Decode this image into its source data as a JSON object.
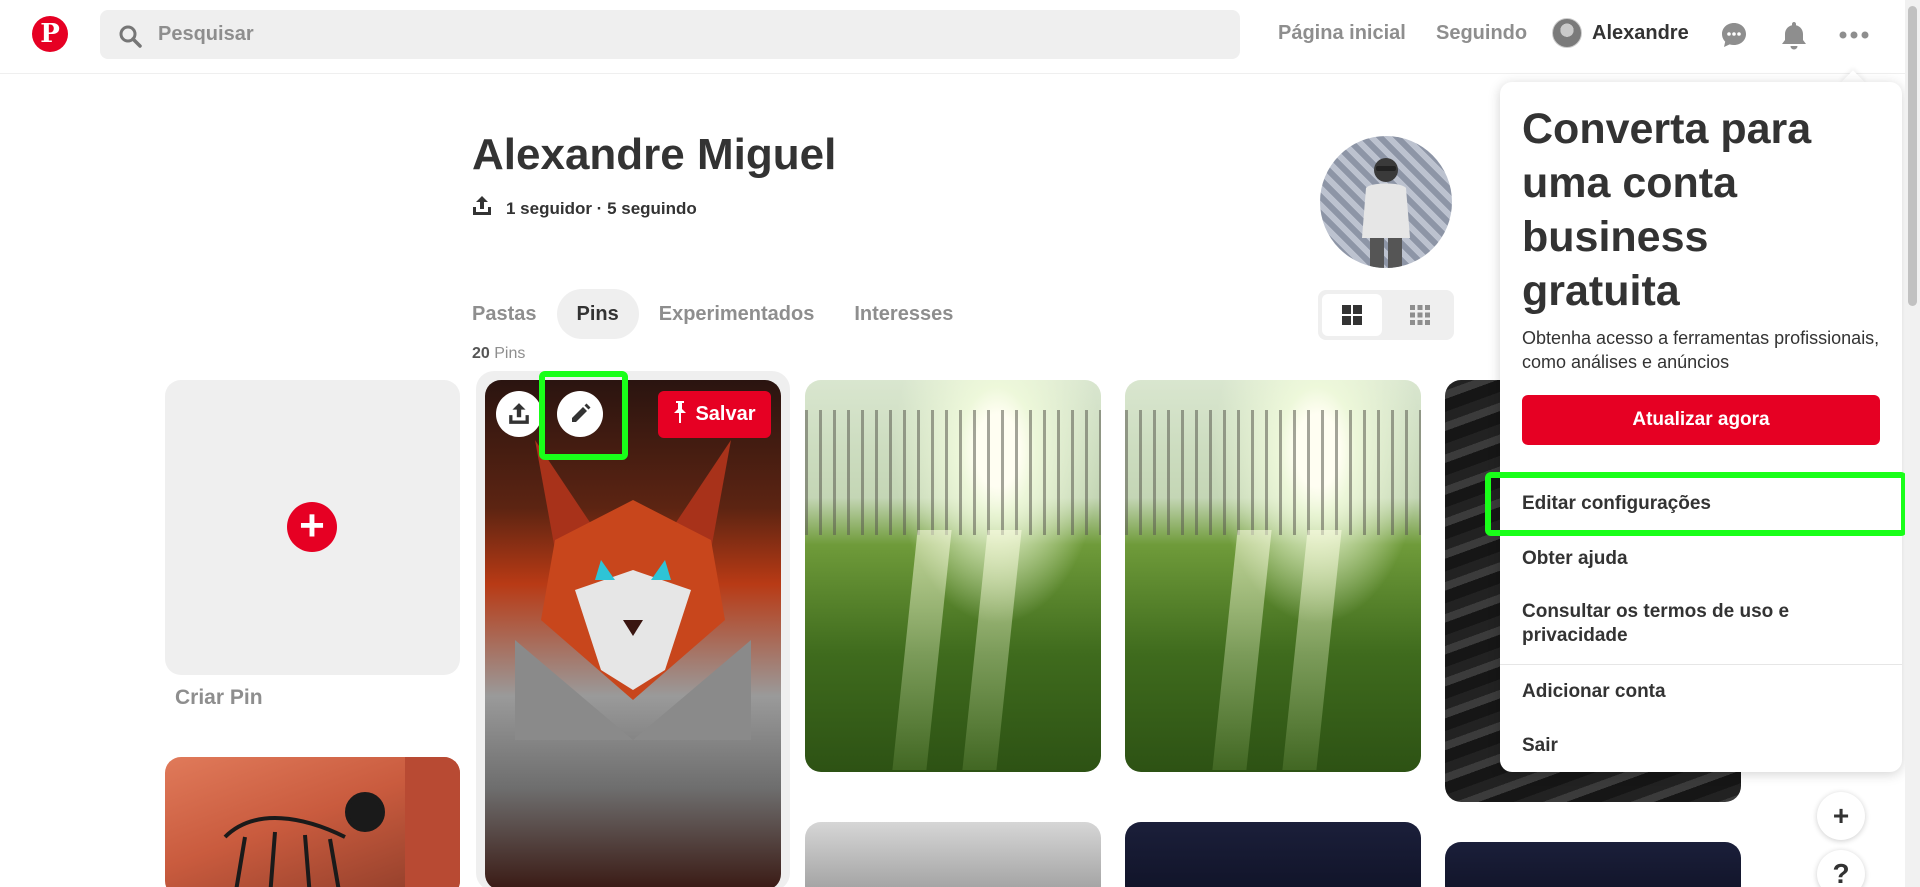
{
  "header": {
    "search_placeholder": "Pesquisar",
    "nav_home": "Página inicial",
    "nav_following": "Seguindo",
    "user_name": "Alexandre"
  },
  "profile": {
    "name": "Alexandre Miguel",
    "stats": "1 seguidor · 5 seguindo",
    "tabs": [
      {
        "label": "Pastas",
        "active": false
      },
      {
        "label": "Pins",
        "active": true
      },
      {
        "label": "Experimentados",
        "active": false
      },
      {
        "label": "Interesses",
        "active": false
      }
    ],
    "pin_count_number": "20",
    "pin_count_label": "Pins"
  },
  "grid": {
    "create_pin_label": "Criar Pin",
    "save_label": "Salvar"
  },
  "dropdown": {
    "title": "Converta para uma conta business gratuita",
    "description": "Obtenha acesso a ferramentas profissionais, como análises e anúncios",
    "upgrade_label": "Atualizar agora",
    "items": [
      "Editar configurações",
      "Obter ajuda",
      "Consultar os termos de uso e privacidade",
      "Adicionar conta",
      "Sair"
    ]
  },
  "floating": {
    "add_label": "+",
    "help_label": "?"
  },
  "colors": {
    "brand_red": "#e60023",
    "highlight_green": "#19ff19",
    "muted_text": "#8e8e8e"
  }
}
